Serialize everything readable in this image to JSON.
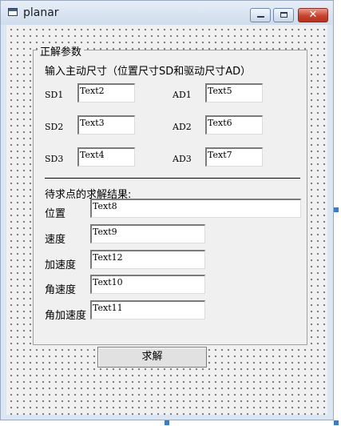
{
  "window": {
    "title": "planar",
    "icon": "form-icon",
    "controls": [
      "minimize-icon",
      "maximize-icon",
      "close-icon"
    ]
  },
  "frame": {
    "caption": "正解参数",
    "instruction": "输入主动尺寸（位置尺寸SD和驱动尺寸AD）"
  },
  "inputs": {
    "sd_labels": [
      "SD1",
      "SD2",
      "SD3"
    ],
    "sd_values": [
      "Text2",
      "Text3",
      "Text4"
    ],
    "ad_labels": [
      "AD1",
      "AD2",
      "AD3"
    ],
    "ad_values": [
      "Text5",
      "Text6",
      "Text7"
    ]
  },
  "results": {
    "heading": "待求点的求解结果:",
    "rows": [
      {
        "label": "位置",
        "value": "Text8"
      },
      {
        "label": "速度",
        "value": "Text9"
      },
      {
        "label": "加速度",
        "value": "Text12"
      },
      {
        "label": "角速度",
        "value": "Text10"
      },
      {
        "label": "角加速度",
        "value": "Text11"
      }
    ]
  },
  "buttons": {
    "solve": "求解"
  },
  "colors": {
    "selection_handle": "#2f7fd6",
    "close_button": "#c7432f"
  }
}
